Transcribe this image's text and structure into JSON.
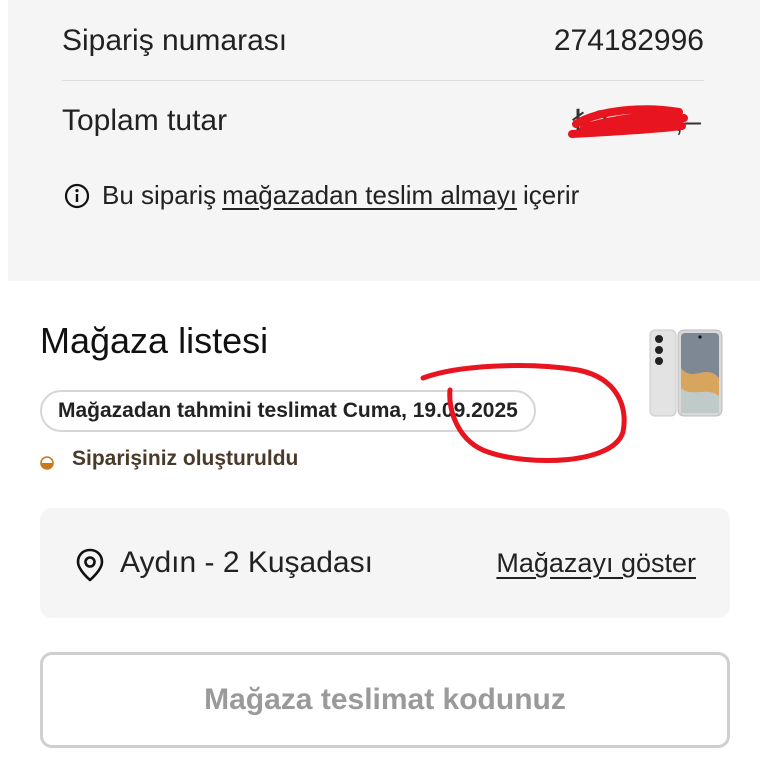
{
  "summary": {
    "order_label": "Sipariş numarası",
    "order_number": "274182996",
    "total_label": "Toplam tutar",
    "total_value_visible": "₺2",
    "total_value_suffix": ",–",
    "info_prefix": "Bu sipariş",
    "info_link": "mağazadan teslim almayı",
    "info_suffix": "içerir",
    "info_icon": "info-icon"
  },
  "store": {
    "title": "Mağaza listesi",
    "estimated_delivery": "Mağazadan tahmini teslimat Cuma, 19.09.2025",
    "status": "Siparişiniz oluşturuldu",
    "status_color": "#c8781e",
    "product_image": "smartphone-image"
  },
  "location": {
    "icon": "location-pin-icon",
    "name": "Aydın - 2 Kuşadası",
    "show_link": "Mağazayı göster"
  },
  "delivery_code_button": "Mağaza teslimat kodunuz",
  "annotation_color": "#e8141f"
}
